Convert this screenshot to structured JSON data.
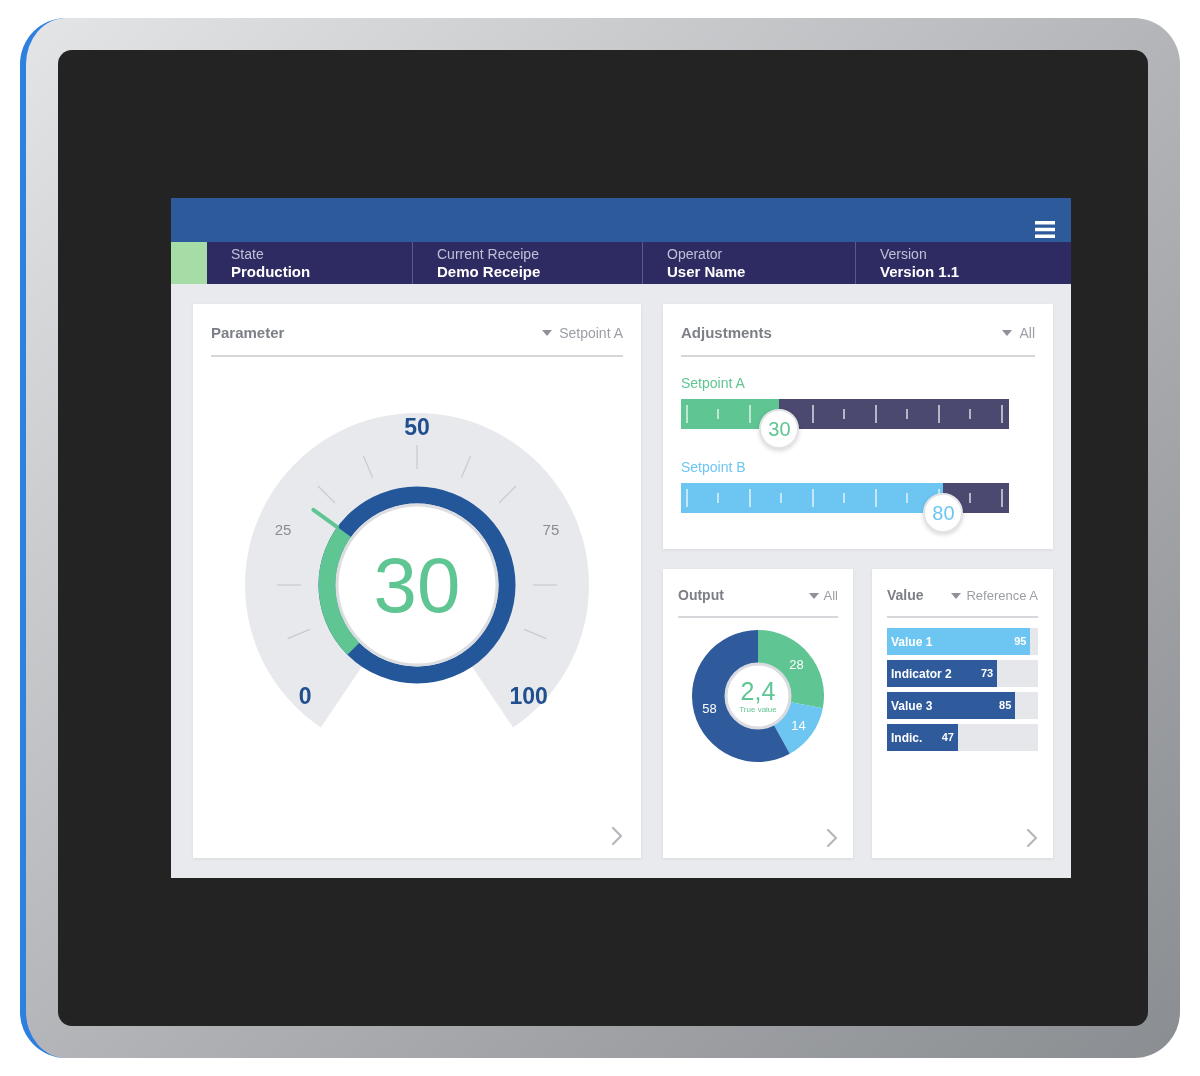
{
  "info_bar": [
    {
      "label": "State",
      "value": "Production"
    },
    {
      "label": "Current Receipe",
      "value": "Demo Receipe"
    },
    {
      "label": "Operator",
      "value": "User Name"
    },
    {
      "label": "Version",
      "value": "Version 1.1"
    }
  ],
  "parameter": {
    "title": "Parameter",
    "filter": "Setpoint A",
    "gauge": {
      "value": "30",
      "level": 0.3,
      "scale": [
        {
          "text": "0",
          "kind": "major"
        },
        {
          "text": "25",
          "kind": "minor"
        },
        {
          "text": "50",
          "kind": "major"
        },
        {
          "text": "75",
          "kind": "minor"
        },
        {
          "text": "100",
          "kind": "major"
        }
      ]
    }
  },
  "adjustments": {
    "title": "Adjustments",
    "filter": "All",
    "sliders": [
      {
        "label": "Setpoint A",
        "value": "30",
        "level": 0.3,
        "color": "#5fc592"
      },
      {
        "label": "Setpoint B",
        "value": "80",
        "level": 0.8,
        "color": "#6cc6f1"
      }
    ]
  },
  "output": {
    "title": "Output",
    "filter": "All",
    "chart_data": {
      "type": "donut",
      "values": [
        28,
        14,
        58
      ],
      "data_labels": true
    },
    "center_value": "2,4",
    "center_label": "True value"
  },
  "value": {
    "title": "Value",
    "filter": "Reference A",
    "bars": [
      {
        "label": "Value 1",
        "value": "95",
        "level": 0.95,
        "color": "#6cc6f1"
      },
      {
        "label": "Indicator 2",
        "value": "73",
        "level": 0.73,
        "color": "#2f5a9c"
      },
      {
        "label": "Value 3",
        "value": "85",
        "level": 0.85,
        "color": "#2f5a9c"
      },
      {
        "label": "Indic.",
        "value": "47",
        "level": 0.47,
        "color": "#2f5a9c"
      }
    ]
  }
}
